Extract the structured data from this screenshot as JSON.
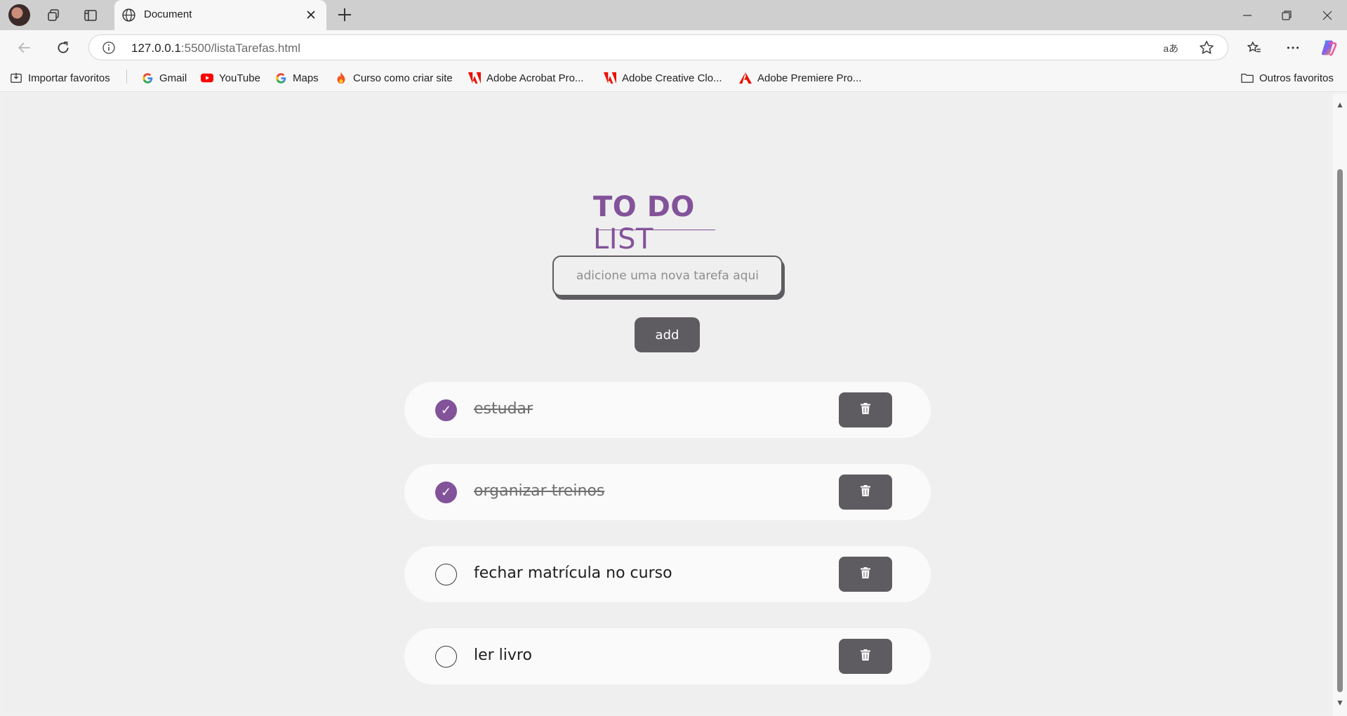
{
  "browser": {
    "tab_title": "Document",
    "url_host": "127.0.0.1",
    "url_rest": ":5500/listaTarefas.html",
    "translate_label": "aあ",
    "bookmarks": [
      {
        "label": "Importar favoritos",
        "icon": "import-icon"
      },
      {
        "label": "Gmail",
        "icon": "google-icon"
      },
      {
        "label": "YouTube",
        "icon": "youtube-icon"
      },
      {
        "label": "Maps",
        "icon": "google-icon"
      },
      {
        "label": "Curso como criar  site",
        "icon": "flame-icon"
      },
      {
        "label": "Adobe Acrobat Pro...",
        "icon": "adobe-icon"
      },
      {
        "label": "Adobe Creative Clo...",
        "icon": "adobe-icon"
      },
      {
        "label": "Adobe Premiere Pro...",
        "icon": "adobe-icon"
      }
    ],
    "other_favorites": "Outros favoritos"
  },
  "app": {
    "title_bold": "TO DO",
    "title_light": "LIST",
    "input_placeholder": "adicione uma nova tarefa aqui",
    "add_label": "add",
    "accent_color": "#83539a",
    "button_color": "#5f5c61",
    "tasks": [
      {
        "text": "estudar",
        "done": true
      },
      {
        "text": "organizar treinos",
        "done": true
      },
      {
        "text": "fechar matrícula no curso",
        "done": false
      },
      {
        "text": "ler livro",
        "done": false
      }
    ]
  }
}
